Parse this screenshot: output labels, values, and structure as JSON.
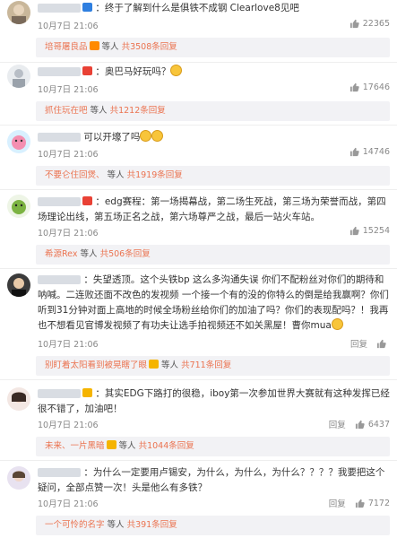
{
  "comments": [
    {
      "content": "：终于了解到什么是俱铁不成钢 Clearlove8见吧",
      "time": "10月7日 21:06",
      "likes": "22365",
      "reply_name": "培哥屠良品",
      "reply_text": "等人",
      "reply_link": "共3508条回复"
    },
    {
      "content": "：奥巴马好玩吗？",
      "time": "10月7日 21:06",
      "likes": "17646",
      "reply_name": "抓住玩在吧",
      "reply_text": "等人",
      "reply_link": "共1212条回复"
    },
    {
      "content": "可以开壕了吗",
      "time": "10月7日 21:06",
      "likes": "14746",
      "reply_name": "不要仑住回煲、",
      "reply_text": "等人",
      "reply_link": "共1919条回复"
    },
    {
      "content": "：edg赛程：第一场揭幕战，第二场生死战，第三场为荣誉而战，第四场理论出线，第五场正名之战，第六场尊严之战，最后一站火车站。",
      "time": "10月7日 21:06",
      "likes": "15254",
      "reply_name": "希源Rex",
      "reply_text": "等人",
      "reply_link": "共506条回复"
    },
    {
      "content": "：失望透顶。这个头铁bp 这么多沟通失误 你们不配粉丝对你们的期待和呐喊。二连败还面不改色的发视频 一个接一个有的没的你特么的倒是给我赢啊？你们听到31分钟对面上高地的时候全场粉丝给你们的加油了吗？你们的表现配吗？！我再也不想看见官博发视频了有功夫让选手拍视频还不如关黑屋！曹你mua",
      "time": "10月7日 21:06",
      "likes": "",
      "reply_name": "别盯着太阳看到被晃瞎了眼",
      "reply_text": "等人",
      "reply_link": "共711条回复"
    },
    {
      "content": "：其实EDG下路打的很稳，iboy第一次参加世界大赛就有这种发挥已经很不错了，加油吧！",
      "time": "10月7日 21:06",
      "likes": "6437",
      "reply_name": "未来、一片黑暗",
      "reply_text": "等人",
      "reply_link": "共1044条回复"
    },
    {
      "content": "：为什么一定要用卢锡安，为什么，为什么，为什么？？？？我要把这个疑问，全部点赞一次！头是他么有多铁？",
      "time": "10月7日 21:06",
      "likes": "7172",
      "reply_name": "一个可怜的名字",
      "reply_text": "等人",
      "reply_link": "共391条回复"
    }
  ],
  "labels": {
    "reply": "回复"
  }
}
